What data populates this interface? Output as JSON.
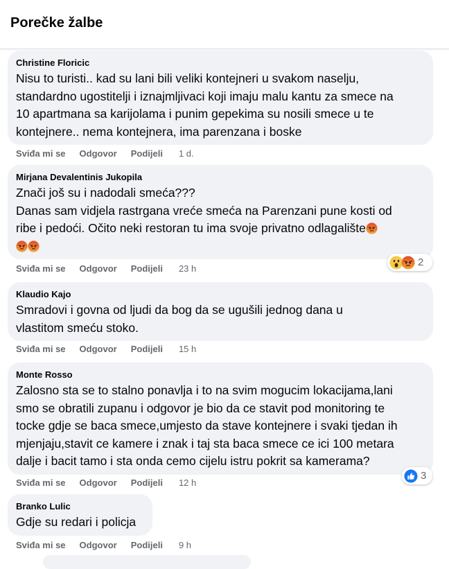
{
  "header": {
    "title": "Porečke žalbe"
  },
  "actions": {
    "like": "Sviđa mi se",
    "reply": "Odgovor",
    "share": "Podijeli"
  },
  "comments": [
    {
      "author": "Christine Floricic",
      "text": "Nisu to turisti.. kad su lani bili veliki kontejneri u svakom naselju,\nstandardno ugostitelji i iznajmljivaci koji imaju malu kantu za smece na\n10 apartmana sa karijolama i punim gepekima su nosili smece u te\nkontejnere.. nema kontejnera, ima parenzana i boske",
      "time": "1 d."
    },
    {
      "author": "Mirjana Devalentinis Jukopila",
      "text": "Znači još su i nadodali smeća???\nDanas sam vidjela rastrgana vreće smeća na Parenzani pune kosti od\nribe i pedoći. Očito neki restoran tu ima svoje privatno odlagalište",
      "time": "23 h",
      "reactions": {
        "icons": [
          "wow-reaction-icon",
          "angry-reaction-icon"
        ],
        "count": "2"
      }
    },
    {
      "author": "Klaudio Kajo",
      "text": "Smradovi i govna od ljudi da bog da se ugušili jednog dana u\nvlastitom smeću stoko.",
      "time": "15 h"
    },
    {
      "author": "Monte Rosso",
      "text": "Zalosno sta se to stalno ponavlja i to na svim mogucim lokacijama,lani\nsmo se obratili zupanu i odgovor je bio da ce stavit pod monitoring te\ntocke gdje se baca smece,umjesto da stave kontejnere i svaki tjedan ih\nmjenjaju,stavit ce kamere i znak i taj sta baca smece ce ici 100 metara\ndalje i bacit tamo i sta onda cemo cijelu istru pokrit sa kamerama?",
      "time": "12 h",
      "reactions": {
        "icons": [
          "like-reaction-icon"
        ],
        "count": "3"
      }
    },
    {
      "author": "Branko Lulic",
      "text": "Gdje su redari i policja",
      "time": "9 h"
    }
  ],
  "colors": {
    "bubble": "#f0f2f5",
    "meta": "#65676b",
    "like_blue": "#1877f2",
    "angry": "#e9710f",
    "wow": "#f7b125"
  }
}
